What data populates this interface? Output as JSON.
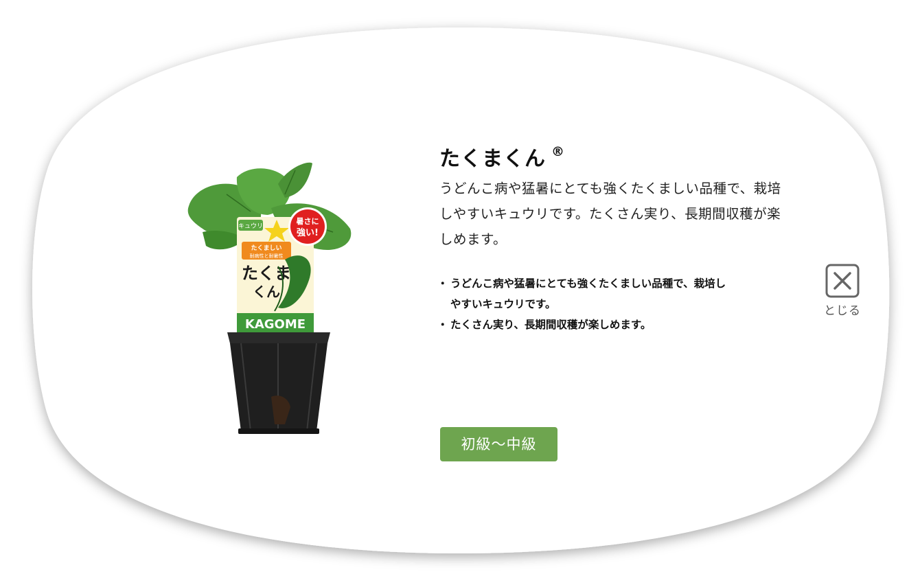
{
  "colors": {
    "modal_background": "#ffffff",
    "shadow": "#b0b0b0",
    "badge_green": "#6ea54f",
    "close_gray": "#666666",
    "leaf_green": "#4f9a3a",
    "pot_black": "#1f1f1f",
    "tag_cream": "#fbf5d6",
    "sticker_red": "#e02020"
  },
  "product": {
    "name": "たくまくん",
    "registered_mark": "®",
    "description": "うどんこ病や猛暑にとても強くたくましい品種で、栽培しやすいキュウリです。たくさん実り、長期間収穫が楽しめます。",
    "bullets": [
      "うどんこ病や猛暑にとても強くたくましい品種で、栽培しやすいキュウリです。",
      "たくさん実り、長期間収穫が楽しめます。"
    ],
    "level": "初級〜中級",
    "image_label": {
      "kind": "キュウリ",
      "sticker_line1": "暑さに",
      "sticker_line2": "強い!",
      "orange_line1": "たくましい",
      "orange_line2": "耐病性と耐暑性",
      "tag_name_line1": "たくま",
      "tag_name_line2": "くん",
      "brand": "KAGOME"
    }
  },
  "close": {
    "icon": "close-icon",
    "label": "とじる"
  }
}
